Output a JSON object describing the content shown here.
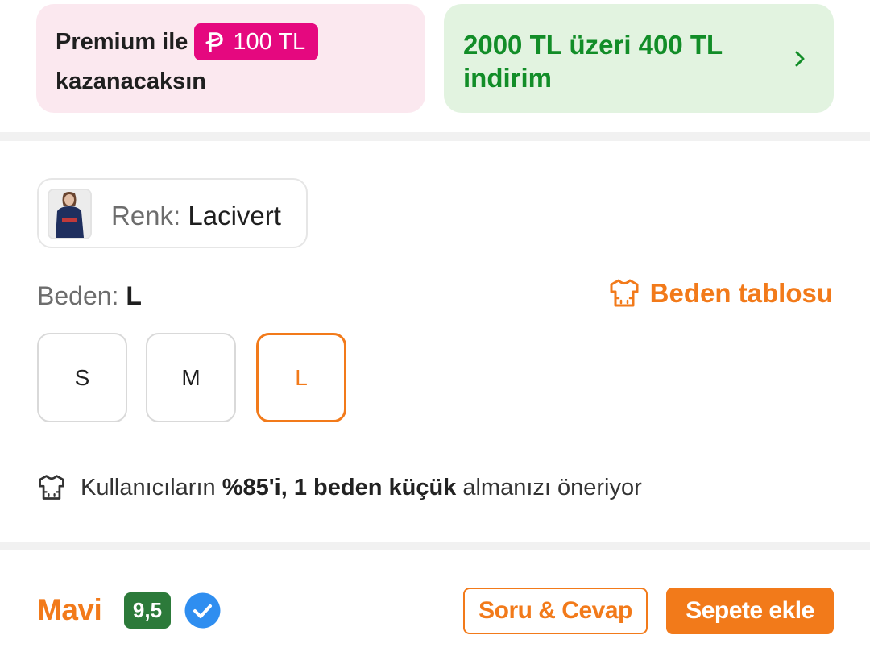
{
  "promo": {
    "premium_prefix": "Premium ile",
    "premium_badge": "100 TL",
    "premium_suffix": "kazanacaksın",
    "discount_text": "2000 TL üzeri 400 TL indirim"
  },
  "color": {
    "label": "Renk:",
    "value": "Lacivert"
  },
  "size": {
    "label": "Beden:",
    "selected": "L",
    "chart_link": "Beden tablosu",
    "options": [
      "S",
      "M",
      "L"
    ]
  },
  "fit_note": {
    "prefix": "Kullanıcıların",
    "bold": "%85'i, 1 beden küçük",
    "suffix": "almanızı öneriyor"
  },
  "footer": {
    "brand": "Mavi",
    "score": "9,5",
    "qa_button": "Soru & Cevap",
    "cart_button": "Sepete ekle"
  },
  "colors": {
    "accent": "#f27a1a",
    "premium_pink": "#e5087f",
    "discount_green": "#128d28",
    "score_green": "#2c7a3a",
    "verified_blue": "#2f8ef0"
  },
  "icons": {
    "premium_coin": "premium-coin-icon",
    "chevron": "chevron-right-icon",
    "size_chart": "shirt-icon",
    "verified": "verified-check-icon"
  }
}
